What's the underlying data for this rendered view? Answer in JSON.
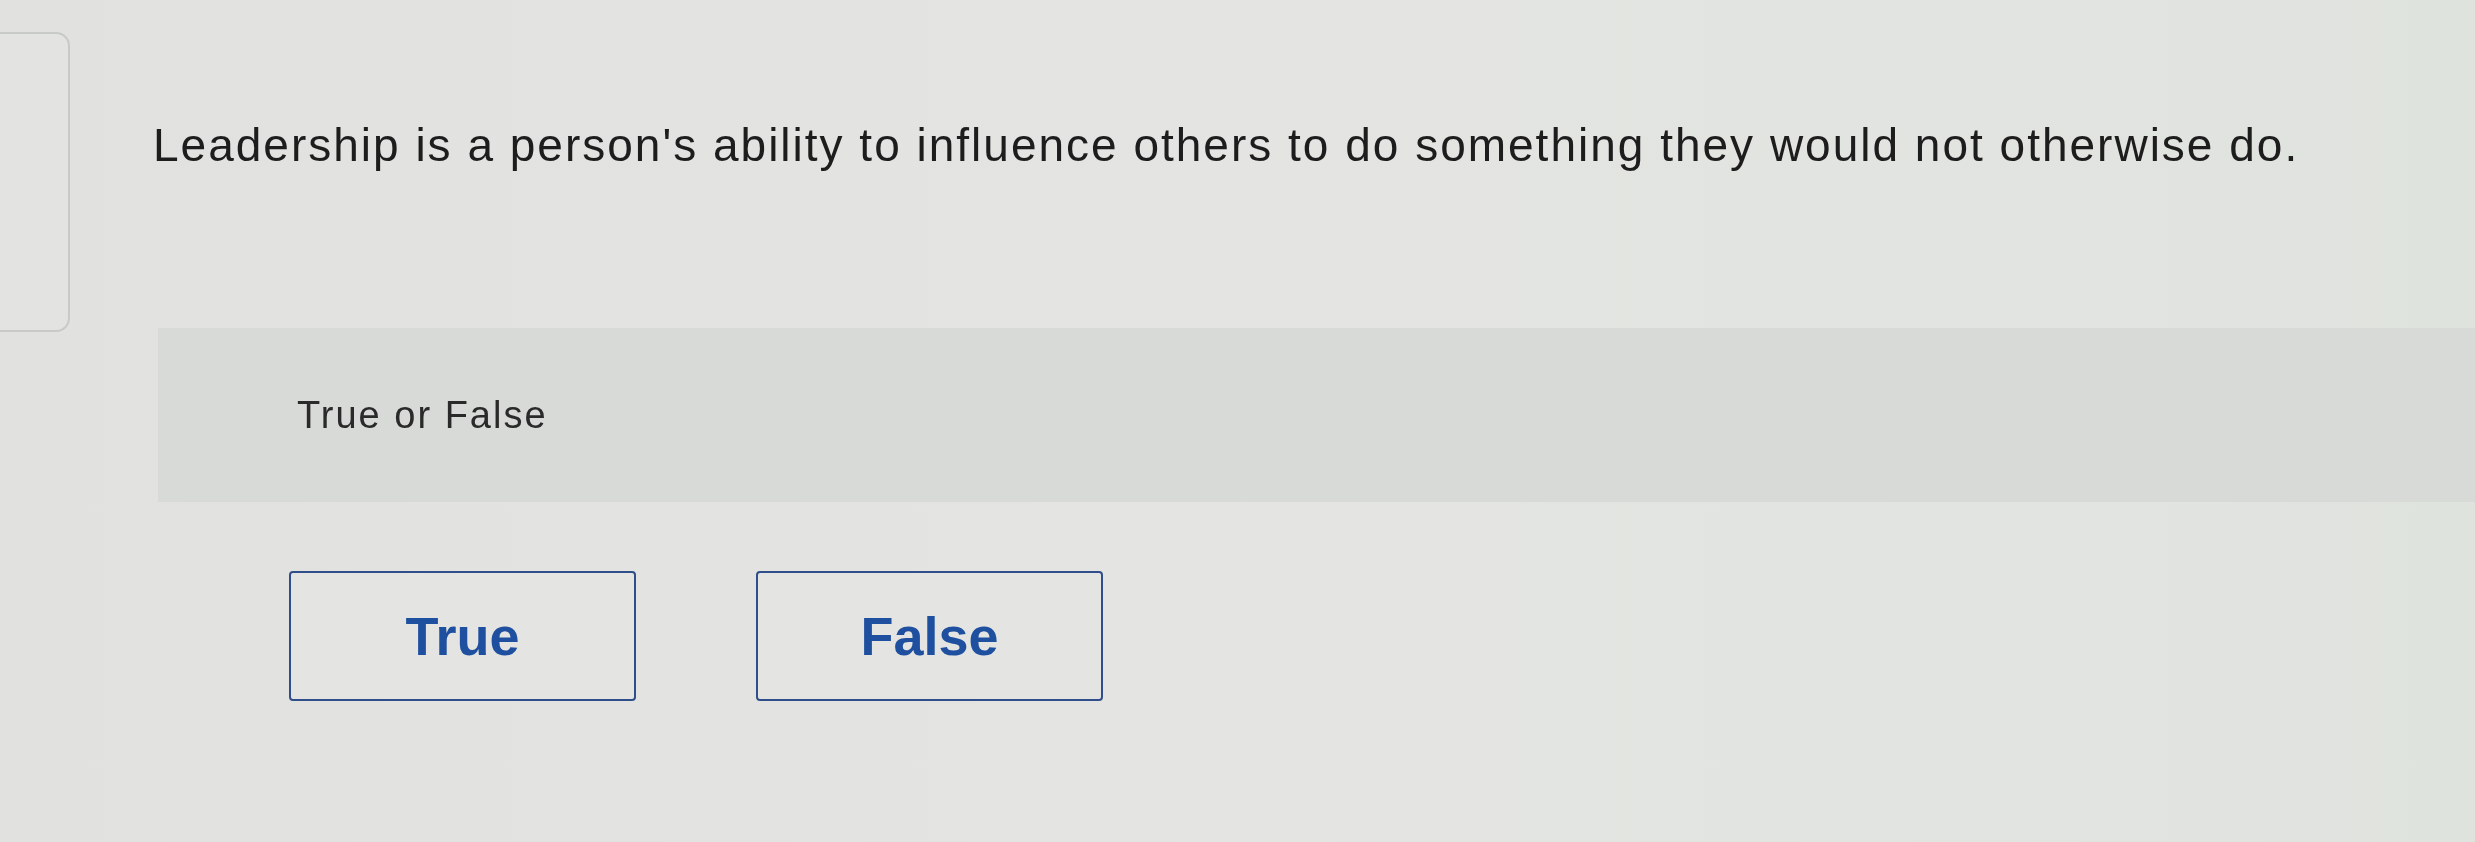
{
  "question": {
    "text": "Leadership is a person's ability to influence others to do something they would not otherwise do."
  },
  "prompt": {
    "text": "True or False"
  },
  "options": [
    {
      "label": "True",
      "selected": false
    },
    {
      "label": "False",
      "selected": false
    }
  ]
}
